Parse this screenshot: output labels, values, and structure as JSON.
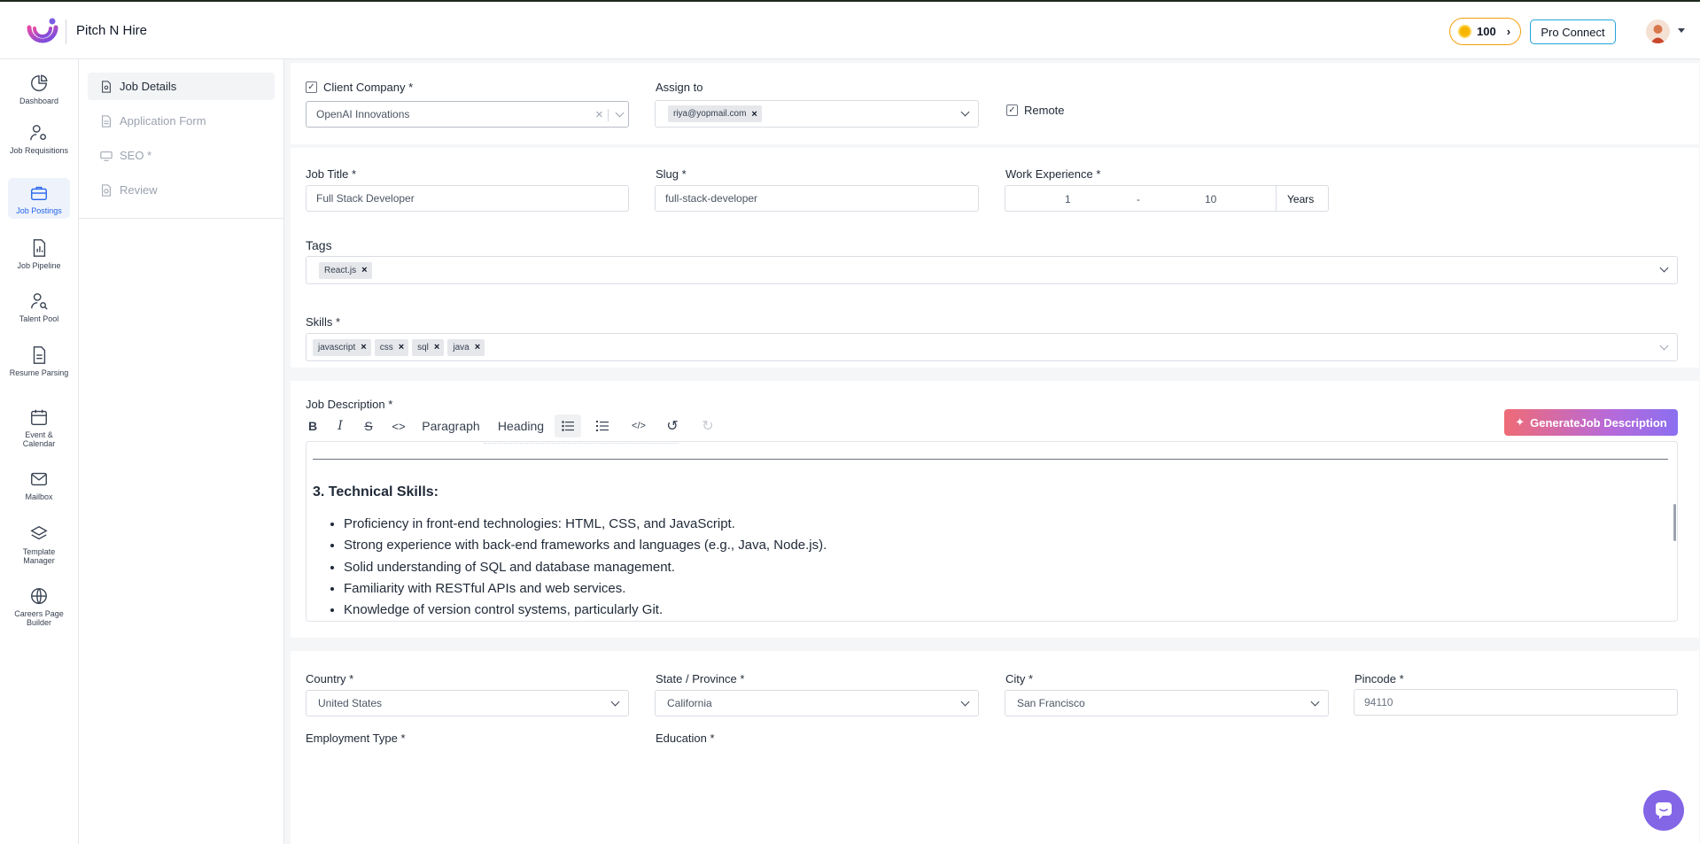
{
  "app": {
    "name": "Pitch N Hire"
  },
  "header": {
    "coins": "100",
    "pro_connect": "Pro Connect"
  },
  "rail": {
    "items": [
      {
        "label": "Dashboard",
        "icon": "pie-chart-icon"
      },
      {
        "label": "Job Requisitions",
        "icon": "user-gear-icon"
      },
      {
        "label": "Job Postings",
        "icon": "briefcase-icon"
      },
      {
        "label": "Job Pipeline",
        "icon": "file-chart-icon"
      },
      {
        "label": "Talent Pool",
        "icon": "user-search-icon"
      },
      {
        "label": "Resume Parsing",
        "icon": "document-icon"
      },
      {
        "label": "Event & Calendar",
        "icon": "calendar-icon"
      },
      {
        "label": "Mailbox",
        "icon": "mail-icon"
      },
      {
        "label": "Template Manager",
        "icon": "layers-icon"
      },
      {
        "label": "Careers Page Builder",
        "icon": "globe-icon"
      }
    ]
  },
  "steps": {
    "items": [
      {
        "label": "Job Details",
        "active": true
      },
      {
        "label": "Application Form",
        "active": false
      },
      {
        "label": "SEO *",
        "active": false
      },
      {
        "label": "Review",
        "active": false
      }
    ]
  },
  "form": {
    "client_company_label": "Client Company",
    "client_company_value": "OpenAI Innovations",
    "assign_to_label": "Assign to",
    "assign_to_chip": "riya@yopmail.com",
    "remote_label": "Remote",
    "job_title_label": "Job Title",
    "job_title_value": "Full Stack Developer",
    "slug_label": "Slug",
    "slug_value": "full-stack-developer",
    "work_experience_label": "Work Experience",
    "exp_min": "1",
    "exp_dash": "-",
    "exp_max": "10",
    "exp_unit": "Years",
    "tags_label": "Tags",
    "tags": [
      "React.js"
    ],
    "skills_label": "Skills",
    "skills": [
      "javascript",
      "css",
      "sql",
      "java"
    ],
    "required_mark": "*"
  },
  "description": {
    "label": "Job Description",
    "generate_button": "GenerateJob Description",
    "toolbar": {
      "paragraph": "Paragraph",
      "heading": "Heading"
    },
    "heading": "3. Technical Skills:",
    "bullets": [
      "Proficiency in front-end technologies: HTML, CSS, and JavaScript.",
      "Strong experience with back-end frameworks and languages (e.g., Java, Node.js).",
      "Solid understanding of SQL and database management.",
      "Familiarity with RESTful APIs and web services.",
      "Knowledge of version control systems, particularly Git."
    ]
  },
  "location": {
    "country_label": "Country",
    "country_value": "United States",
    "state_label": "State / Province",
    "state_value": "California",
    "city_label": "City",
    "city_value": "San Francisco",
    "pincode_label": "Pincode",
    "pincode_value": "94110",
    "employment_type_label": "Employment Type",
    "education_label": "Education"
  },
  "colors": {
    "accent": "#2563eb",
    "brand": "#7c5ce6",
    "coin_border": "#f59e0b",
    "pro_border": "#22a3d8"
  }
}
